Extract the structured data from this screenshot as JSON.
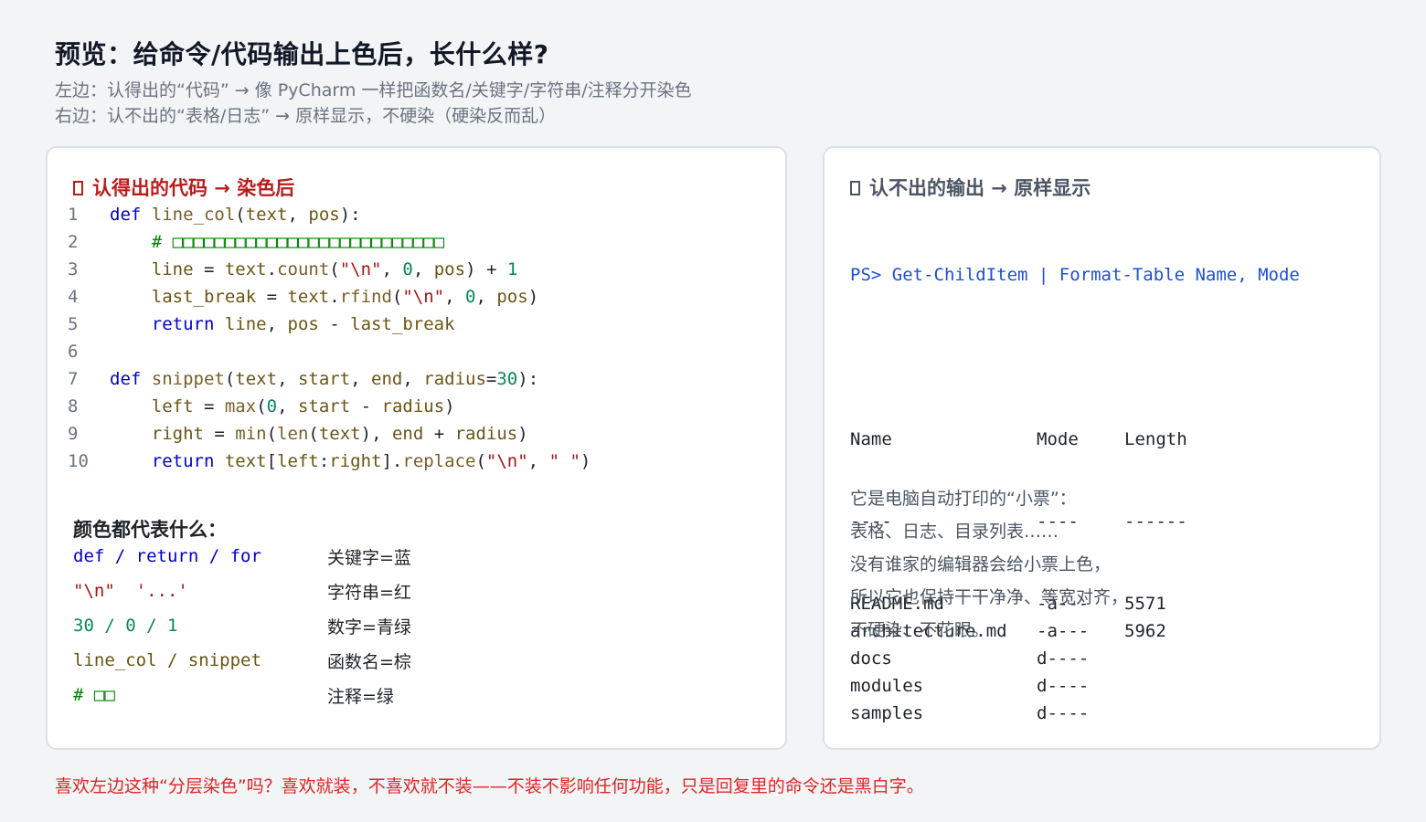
{
  "header": {
    "title": "预览：给命令/代码输出上色后，长什么样?",
    "subtitle_1": "左边：认得出的“代码” → 像 PyCharm 一样把函数名/关键字/字符串/注释分开染色",
    "subtitle_2": "右边：认不出的“表格/日志” → 原样显示，不硬染（硬染反而乱）"
  },
  "left_card": {
    "heading": "认得出的代码 → 染色后",
    "code_lines": [
      {
        "n": "1",
        "tokens": [
          [
            "kw",
            "def "
          ],
          [
            "fn",
            "line_col"
          ],
          [
            "op",
            "("
          ],
          [
            "id",
            "text"
          ],
          [
            "op",
            ", "
          ],
          [
            "id",
            "pos"
          ],
          [
            "op",
            "):"
          ]
        ]
      },
      {
        "n": "2",
        "tokens": [
          [
            "op",
            "    "
          ],
          [
            "cm",
            "# □□□□□□□□□□□□□□□□□□□□□□□□□□"
          ]
        ]
      },
      {
        "n": "3",
        "tokens": [
          [
            "op",
            "    "
          ],
          [
            "id",
            "line"
          ],
          [
            "op",
            " = "
          ],
          [
            "id",
            "text"
          ],
          [
            "op",
            "."
          ],
          [
            "fn",
            "count"
          ],
          [
            "op",
            "("
          ],
          [
            "str",
            "\"\\n\""
          ],
          [
            "op",
            ", "
          ],
          [
            "num",
            "0"
          ],
          [
            "op",
            ", "
          ],
          [
            "id",
            "pos"
          ],
          [
            "op",
            ") + "
          ],
          [
            "num",
            "1"
          ]
        ]
      },
      {
        "n": "4",
        "tokens": [
          [
            "op",
            "    "
          ],
          [
            "id",
            "last_break"
          ],
          [
            "op",
            " = "
          ],
          [
            "id",
            "text"
          ],
          [
            "op",
            "."
          ],
          [
            "fn",
            "rfind"
          ],
          [
            "op",
            "("
          ],
          [
            "str",
            "\"\\n\""
          ],
          [
            "op",
            ", "
          ],
          [
            "num",
            "0"
          ],
          [
            "op",
            ", "
          ],
          [
            "id",
            "pos"
          ],
          [
            "op",
            ")"
          ]
        ]
      },
      {
        "n": "5",
        "tokens": [
          [
            "op",
            "    "
          ],
          [
            "kw",
            "return "
          ],
          [
            "id",
            "line"
          ],
          [
            "op",
            ", "
          ],
          [
            "id",
            "pos"
          ],
          [
            "op",
            " - "
          ],
          [
            "id",
            "last_break"
          ]
        ]
      },
      {
        "n": "6",
        "tokens": []
      },
      {
        "n": "7",
        "tokens": [
          [
            "kw",
            "def "
          ],
          [
            "fn",
            "snippet"
          ],
          [
            "op",
            "("
          ],
          [
            "id",
            "text"
          ],
          [
            "op",
            ", "
          ],
          [
            "id",
            "start"
          ],
          [
            "op",
            ", "
          ],
          [
            "id",
            "end"
          ],
          [
            "op",
            ", "
          ],
          [
            "id",
            "radius"
          ],
          [
            "op",
            "="
          ],
          [
            "num",
            "30"
          ],
          [
            "op",
            "):"
          ]
        ]
      },
      {
        "n": "8",
        "tokens": [
          [
            "op",
            "    "
          ],
          [
            "id",
            "left"
          ],
          [
            "op",
            " = "
          ],
          [
            "fn",
            "max"
          ],
          [
            "op",
            "("
          ],
          [
            "num",
            "0"
          ],
          [
            "op",
            ", "
          ],
          [
            "id",
            "start"
          ],
          [
            "op",
            " - "
          ],
          [
            "id",
            "radius"
          ],
          [
            "op",
            ")"
          ]
        ]
      },
      {
        "n": "9",
        "tokens": [
          [
            "op",
            "    "
          ],
          [
            "id",
            "right"
          ],
          [
            "op",
            " = "
          ],
          [
            "fn",
            "min"
          ],
          [
            "op",
            "("
          ],
          [
            "fn",
            "len"
          ],
          [
            "op",
            "("
          ],
          [
            "id",
            "text"
          ],
          [
            "op",
            "), "
          ],
          [
            "id",
            "end"
          ],
          [
            "op",
            " + "
          ],
          [
            "id",
            "radius"
          ],
          [
            "op",
            ")"
          ]
        ]
      },
      {
        "n": "10",
        "tokens": [
          [
            "op",
            "    "
          ],
          [
            "kw",
            "return "
          ],
          [
            "id",
            "text"
          ],
          [
            "op",
            "["
          ],
          [
            "id",
            "left"
          ],
          [
            "op",
            ":"
          ],
          [
            "id",
            "right"
          ],
          [
            "op",
            "]."
          ],
          [
            "fn",
            "replace"
          ],
          [
            "op",
            "("
          ],
          [
            "str",
            "\"\\n\""
          ],
          [
            "op",
            ", "
          ],
          [
            "str",
            "\" \""
          ],
          [
            "op",
            ")"
          ]
        ]
      }
    ],
    "legend_title": "颜色都代表什么：",
    "legend": [
      {
        "sample": "def / return / for",
        "cls": "kw",
        "meaning": "关键字=蓝"
      },
      {
        "sample": "\"\\n\"  '...'",
        "cls": "str",
        "meaning": "字符串=红"
      },
      {
        "sample": "30 / 0 / 1",
        "cls": "num",
        "meaning": "数字=青绿"
      },
      {
        "sample": "line_col / snippet",
        "cls": "id",
        "meaning": "函数名=棕"
      },
      {
        "sample": "# □□",
        "cls": "cm",
        "meaning": "注释=绿"
      }
    ]
  },
  "right_card": {
    "heading": "认不出的输出 → 原样显示",
    "command": "PS> Get-ChildItem | Format-Table Name, Mode",
    "table_header": [
      "Name",
      "Mode",
      "Length"
    ],
    "table_rule": [
      "----",
      "----",
      "------"
    ],
    "table_rows": [
      [
        "README.md",
        "-a---",
        "5571"
      ],
      [
        "architecture.md",
        "-a---",
        "5962"
      ],
      [
        "docs",
        "d----",
        ""
      ],
      [
        "modules",
        "d----",
        ""
      ],
      [
        "samples",
        "d----",
        ""
      ]
    ],
    "description": [
      "它是电脑自动打印的“小票”：",
      "表格、日志、目录列表……",
      "没有谁家的编辑器会给小票上色，",
      "所以它也保持干干净净、等宽对齐，",
      "不硬染、不花眼。"
    ]
  },
  "footer": {
    "text": "喜欢左边这种“分层染色”吗？喜欢就装，不喜欢就不装——不装不影响任何功能，只是回复里的命令还是黑白字。"
  },
  "colors": {
    "keyword": "#0000cc",
    "string": "#a31515",
    "number": "#098658",
    "function": "#795e26",
    "comment": "#008000",
    "heading_red": "#b91c1c",
    "footer_red": "#dc2626"
  }
}
